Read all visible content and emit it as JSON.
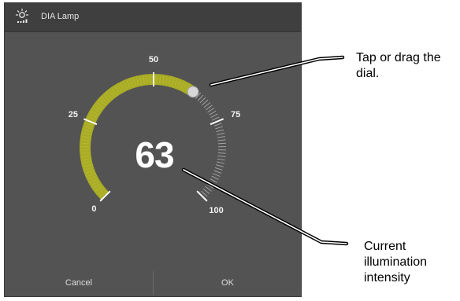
{
  "window": {
    "title": "DIA Lamp",
    "icon": "lamp-icon"
  },
  "dial": {
    "value": "63",
    "min": 0,
    "max": 100,
    "current": 63,
    "scale_labels": [
      "0",
      "25",
      "50",
      "75",
      "100"
    ],
    "accent_color": "#b9bc1f",
    "tick_color": "#bdbdbd"
  },
  "footer": {
    "cancel_label": "Cancel",
    "ok_label": "OK"
  },
  "callouts": {
    "dial_hint": [
      "Tap or drag the",
      "dial."
    ],
    "intensity": [
      "Current",
      "illumination",
      "intensity"
    ]
  }
}
